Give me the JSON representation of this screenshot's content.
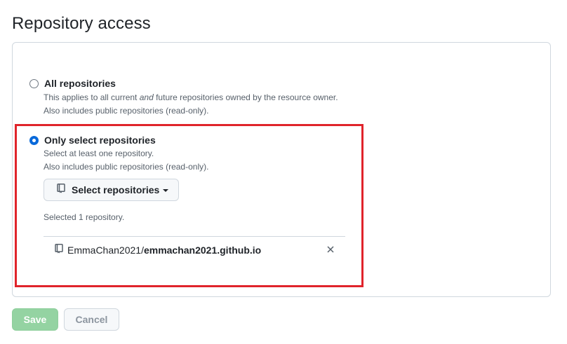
{
  "page": {
    "title": "Repository access"
  },
  "options": {
    "all": {
      "label": "All repositories",
      "desc_before": "This applies to all current ",
      "desc_em": "and",
      "desc_after": " future repositories owned by the resource owner.",
      "desc_line2": "Also includes public repositories (read-only).",
      "checked": false
    },
    "select": {
      "label": "Only select repositories",
      "desc_line1": "Select at least one repository.",
      "desc_line2": "Also includes public repositories (read-only).",
      "checked": true
    }
  },
  "select_button": {
    "label": "Select repositories",
    "icon": "repo-icon"
  },
  "selection": {
    "count_text": "Selected 1 repository.",
    "repos": [
      {
        "owner": "EmmaChan2021",
        "separator": "/",
        "name": "emmachan2021.github.io",
        "icon": "repo-icon",
        "remove_icon": "close-icon"
      }
    ]
  },
  "actions": {
    "save_label": "Save",
    "cancel_label": "Cancel"
  },
  "colors": {
    "accent": "#0969da",
    "highlight": "#e0242b",
    "save_disabled": "#94d3a2"
  }
}
